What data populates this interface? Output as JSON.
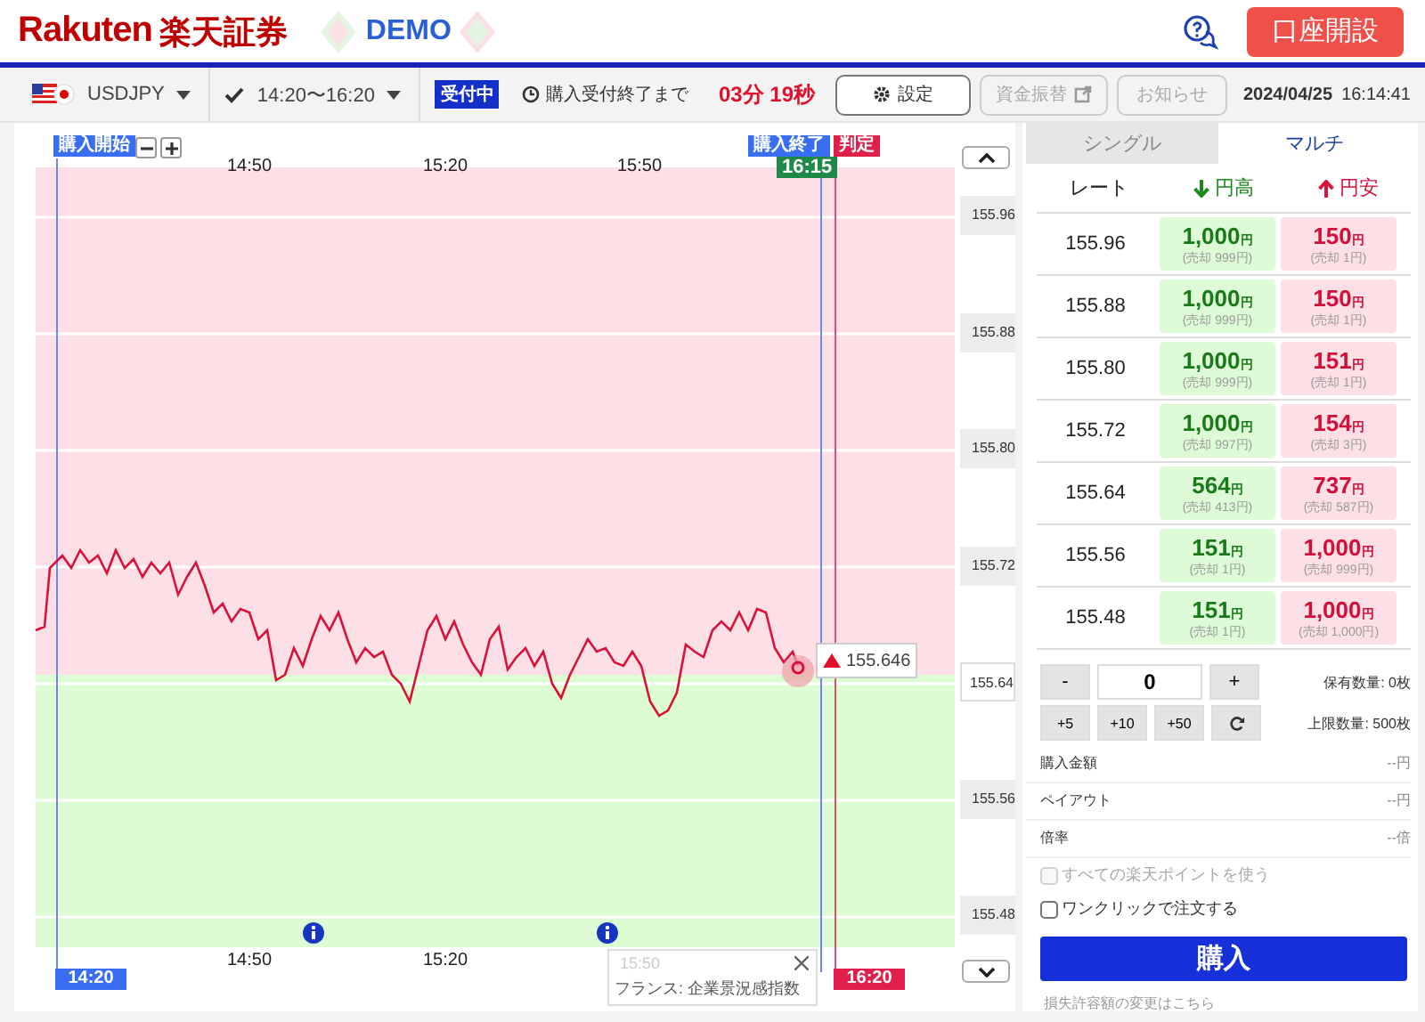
{
  "header": {
    "brand": "Rakuten",
    "brand_jp": "楽天証券",
    "mode": "DEMO",
    "account_button": "口座開設"
  },
  "toolbar": {
    "pair": "USDJPY",
    "session": "14:20〜16:20",
    "status": "受付中",
    "countdown_label": "購入受付終了まで",
    "countdown": "03分 19秒",
    "buttons": [
      {
        "label": "設定",
        "kind": "settings",
        "disabled": false
      },
      {
        "label": "資金振替",
        "kind": "transfer",
        "disabled": true
      },
      {
        "label": "お知らせ",
        "kind": "plain",
        "disabled": true
      }
    ],
    "date": "2024/04/25",
    "time": "16:14:41"
  },
  "chart": {
    "start_label": "購入開始",
    "end_label": "購入終了",
    "judge_label": "判定",
    "end_time": "16:15",
    "start_time": "14:20",
    "judge_time": "16:20",
    "top_times": [
      "14:50",
      "15:20",
      "15:50"
    ],
    "bottom_times": [
      "14:50",
      "15:20"
    ],
    "y_labels": [
      "155.96",
      "155.88",
      "155.80",
      "155.72",
      "155.64",
      "155.56",
      "155.48"
    ],
    "current_price": "155.646",
    "tooltip": {
      "time": "15:50",
      "text": "フランス: 企業景況感指数"
    }
  },
  "panel": {
    "tabs": [
      {
        "label": "シングル",
        "selected": false
      },
      {
        "label": "マルチ",
        "selected": true
      }
    ],
    "columns": [
      {
        "label": "レート",
        "kind": "plain"
      },
      {
        "label": "円高",
        "kind": "down"
      },
      {
        "label": "円安",
        "kind": "up"
      }
    ],
    "rows": [
      {
        "rate": "155.96",
        "high": {
          "price": "1,000",
          "unit": "円",
          "sub": "(売却 999円)"
        },
        "low": {
          "price": "150",
          "unit": "円",
          "sub": "(売却 1円)"
        }
      },
      {
        "rate": "155.88",
        "high": {
          "price": "1,000",
          "unit": "円",
          "sub": "(売却 999円)"
        },
        "low": {
          "price": "150",
          "unit": "円",
          "sub": "(売却 1円)"
        }
      },
      {
        "rate": "155.80",
        "high": {
          "price": "1,000",
          "unit": "円",
          "sub": "(売却 999円)"
        },
        "low": {
          "price": "151",
          "unit": "円",
          "sub": "(売却 1円)"
        }
      },
      {
        "rate": "155.72",
        "high": {
          "price": "1,000",
          "unit": "円",
          "sub": "(売却 997円)"
        },
        "low": {
          "price": "154",
          "unit": "円",
          "sub": "(売却 3円)"
        }
      },
      {
        "rate": "155.64",
        "high": {
          "price": "564",
          "unit": "円",
          "sub": "(売却 413円)"
        },
        "low": {
          "price": "737",
          "unit": "円",
          "sub": "(売却 587円)"
        }
      },
      {
        "rate": "155.56",
        "high": {
          "price": "151",
          "unit": "円",
          "sub": "(売却 1円)"
        },
        "low": {
          "price": "1,000",
          "unit": "円",
          "sub": "(売却 999円)"
        }
      },
      {
        "rate": "155.48",
        "high": {
          "price": "151",
          "unit": "円",
          "sub": "(売却 1円)"
        },
        "low": {
          "price": "1,000",
          "unit": "円",
          "sub": "(売却 1,000円)"
        }
      }
    ],
    "quantity": {
      "minus": "-",
      "value": "0",
      "plus": "+",
      "steps": [
        "+5",
        "+10",
        "+50"
      ],
      "held": "保有数量: 0枚",
      "limit": "上限数量: 500枚"
    },
    "summary": [
      {
        "label": "購入金額",
        "value": "--円"
      },
      {
        "label": "ペイアウト",
        "value": "--円"
      },
      {
        "label": "倍率",
        "value": "--倍"
      }
    ],
    "options": [
      {
        "label": "すべての楽天ポイントを使う",
        "checked": false,
        "disabled": true
      },
      {
        "label": "ワンクリックで注文する",
        "checked": false,
        "disabled": false
      }
    ],
    "buy_button": "購入",
    "link": "損失許容額の変更はこちら"
  }
}
